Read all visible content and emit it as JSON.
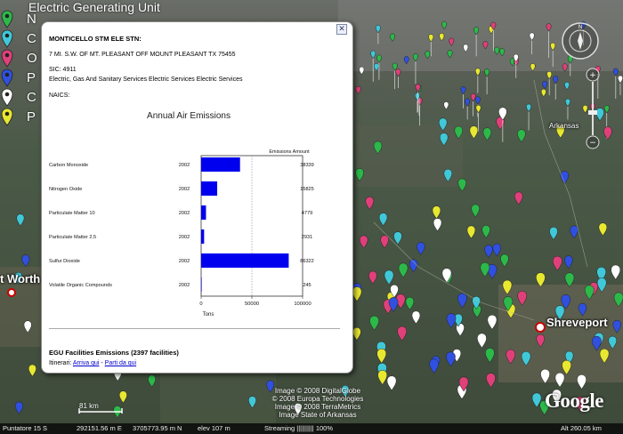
{
  "legend": {
    "title": "Electric Generating Unit",
    "items": [
      {
        "label": "N",
        "color": "#2db84a"
      },
      {
        "label": "C",
        "color": "#40c8d8"
      },
      {
        "label": "O",
        "color": "#e0407a"
      },
      {
        "label": "P",
        "color": "#3050e0"
      },
      {
        "label": "C",
        "color": "#ffffff"
      },
      {
        "label": "P",
        "color": "#e8e830"
      }
    ]
  },
  "map_labels": {
    "arkansas": "Arkansas",
    "shreveport": "Shreveport",
    "fort_worth": "t Worth"
  },
  "popup": {
    "close_symbol": "✕",
    "facility_name": "MONTICELLO STM ELE STN:",
    "address": "7 MI. S.W. OF MT. PLEASANT OFF MOUNT PLEASANT TX 75455",
    "sic": "SIC: 4911",
    "sic_desc": "Electric, Gas And Sanitary Services Electric Services Electric Services",
    "naics": "NAICS:",
    "egu_title": "EGU Facilities Emissions (2397 facilities)",
    "itinerary_label": "Itinerari:",
    "to_here": "Arriva qui",
    "separator": " - ",
    "from_here": "Parti da qui"
  },
  "chart_data": {
    "type": "bar",
    "title": "Annual Air Emissions",
    "value_header": "Emissions Amount",
    "xlabel": "Tons",
    "xlim": [
      0,
      100000
    ],
    "x_ticks": [
      0,
      50000,
      100000
    ],
    "x_tick_labels": [
      "0",
      "50000",
      "100000"
    ],
    "categories": [
      "Carbon Monoxide",
      "Nitrogen Oxide",
      "Particulate Matter 10",
      "Particulate Matter 2.5",
      "Sulfur Dioxide",
      "Volatile Organic Compounds"
    ],
    "years": [
      "2002",
      "2002",
      "2002",
      "2002",
      "2002",
      "2002"
    ],
    "values": [
      38339,
      15825,
      4779,
      2931,
      86322,
      245
    ],
    "value_labels": [
      "38339",
      "15825",
      "4779",
      "2931",
      "86322",
      "245"
    ],
    "bar_color": "#0000ee",
    "grid": "vertical dashed at 50000"
  },
  "credits": [
    "Image © 2008 DigitalGlobe",
    "© 2008 Europa Technologies",
    "Image © 2008 TerraMetrics",
    "Image State of Arkansas"
  ],
  "google_logo": "Google",
  "scale_label": "81 km",
  "status": {
    "pointer": "Puntatore 15 S",
    "easting": "292151.56 m E",
    "northing": "3705773.95 m N",
    "elev": "elev  107 m",
    "streaming": "Streaming |||||||||| 100%",
    "eye_alt": "Alt  260.05 km"
  },
  "nav": {
    "compass_n": "N"
  }
}
